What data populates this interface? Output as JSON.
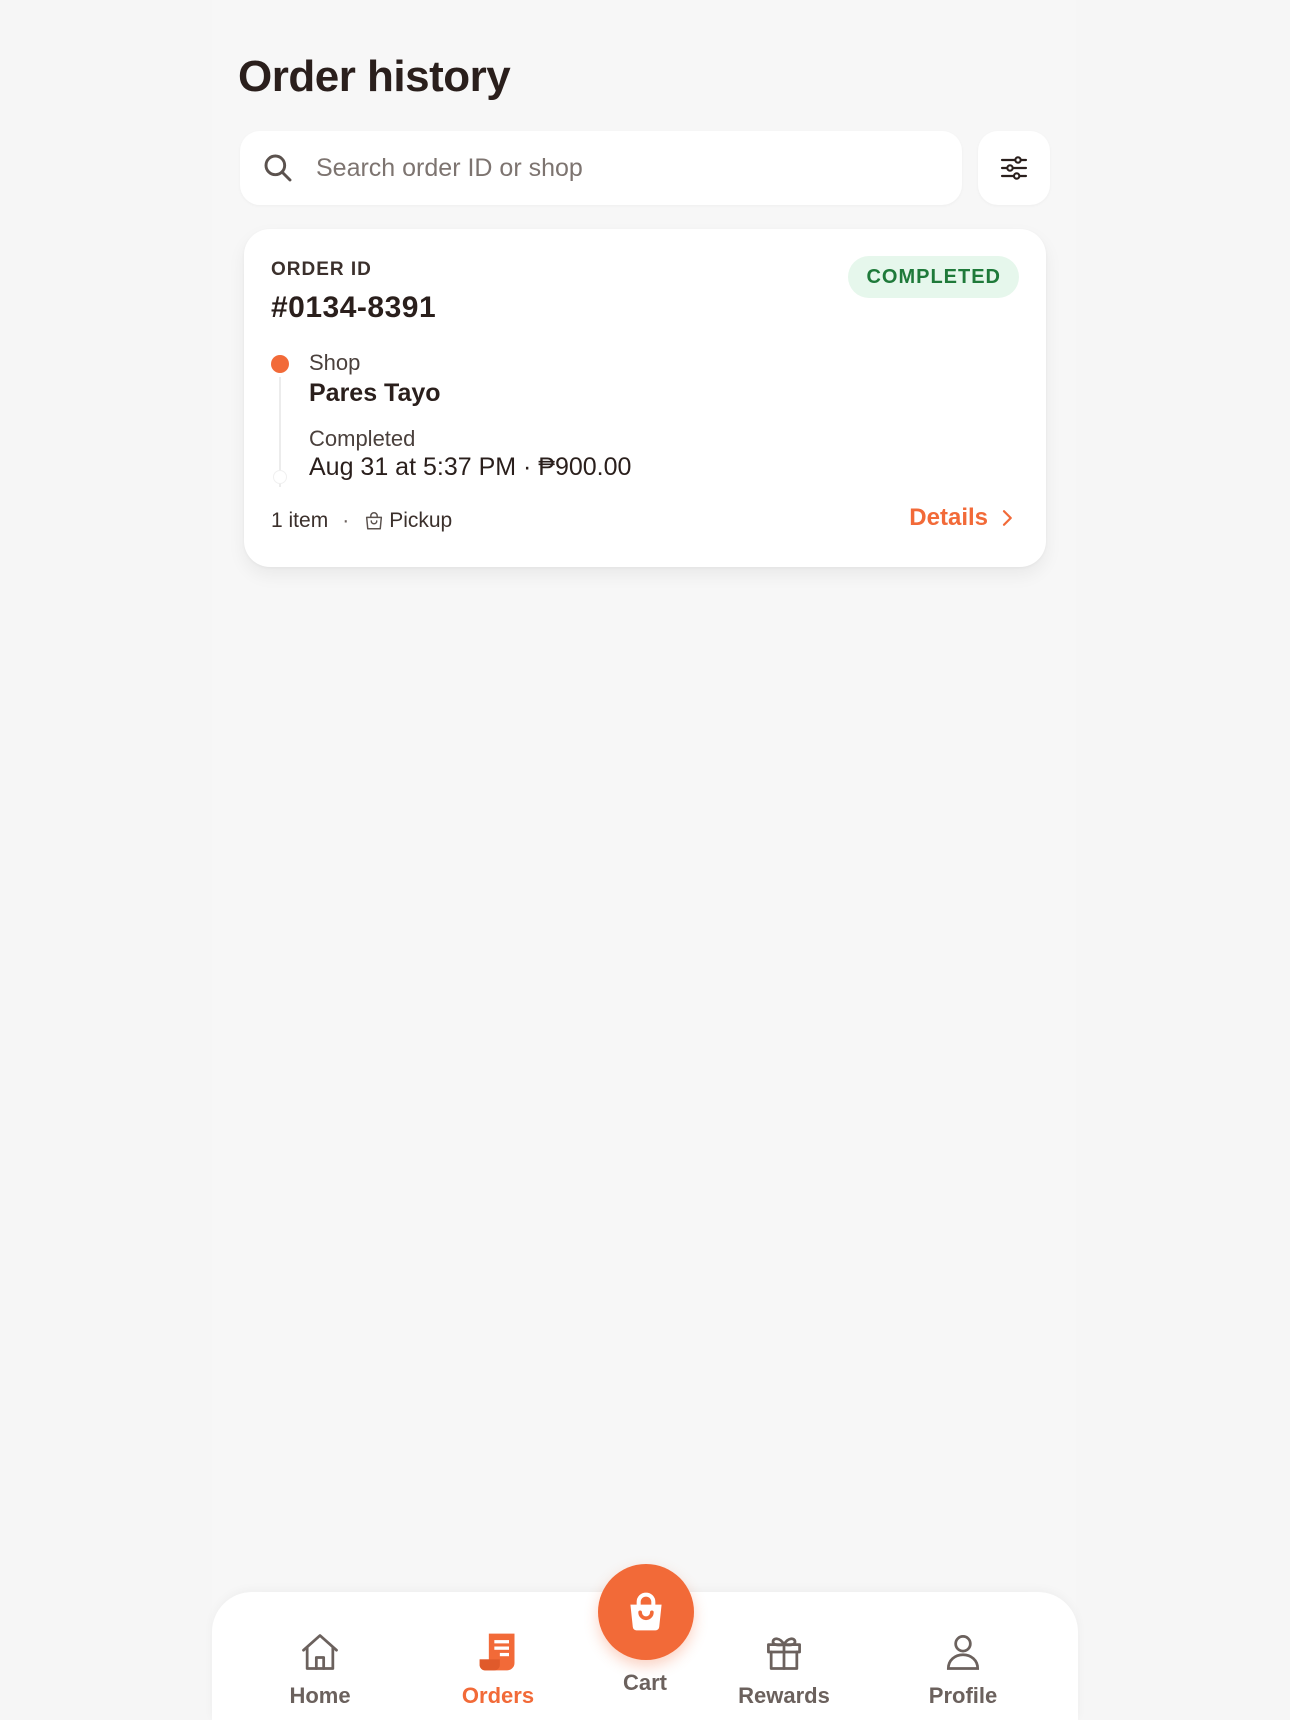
{
  "page": {
    "title": "Order history"
  },
  "search": {
    "placeholder": "Search order ID or shop",
    "value": ""
  },
  "filter": {
    "icon": "sliders-icon"
  },
  "orders": [
    {
      "id_label": "ORDER ID",
      "id": "#0134-8391",
      "status_badge": "COMPLETED",
      "shop_label": "Shop",
      "shop_name": "Pares Tayo",
      "status_label": "Completed",
      "status_detail": "Aug 31 at 5:37 PM · ₱900.00",
      "items": "1 item",
      "separator": "·",
      "fulfillment": "Pickup",
      "details_label": "Details"
    }
  ],
  "nav": {
    "home": "Home",
    "orders": "Orders",
    "cart": "Cart",
    "rewards": "Rewards",
    "profile": "Profile",
    "active": "orders"
  },
  "colors": {
    "accent": "#f26a38",
    "badge_bg": "#e6f7ec",
    "badge_text": "#1f7a3a",
    "text": "#2a1f1c",
    "background": "#f6f6f6"
  }
}
